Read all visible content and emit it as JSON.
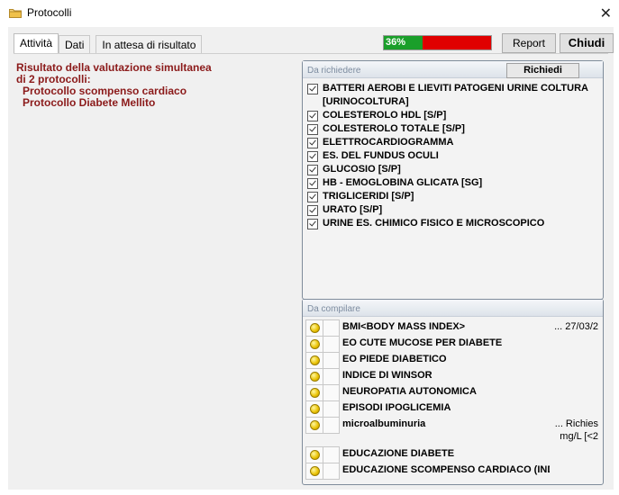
{
  "window": {
    "title": "Protocolli"
  },
  "tabs": [
    {
      "label": "Attività",
      "active": true
    },
    {
      "label": "Dati",
      "active": false
    },
    {
      "label": "In attesa di risultato",
      "active": false
    }
  ],
  "progress": {
    "value": 36,
    "label": "36%",
    "fill_color": "#1a9f2a",
    "rest_color": "#e00000"
  },
  "buttons": {
    "report": "Report",
    "chiudi": "Chiudi"
  },
  "result": {
    "line1": "Risultato della valutazione simultanea",
    "line2": "di 2 protocolli:",
    "protocols": [
      "Protocollo scompenso cardiaco",
      "Protocollo Diabete Mellito"
    ]
  },
  "requests_panel": {
    "title": "Da richiedere",
    "button": "Richiedi",
    "items": [
      "BATTERI AEROBI E LIEVITI PATOGENI URINE COLTURA [URINOCOLTURA]",
      "COLESTEROLO HDL [S/P]",
      "COLESTEROLO TOTALE [S/P]",
      "ELETTROCARDIOGRAMMA",
      "ES. DEL FUNDUS OCULI",
      "GLUCOSIO [S/P]",
      "HB - EMOGLOBINA GLICATA [SG]",
      "TRIGLICERIDI [S/P]",
      "URATO [S/P]",
      "URINE ES. CHIMICO FISICO E MICROSCOPICO"
    ]
  },
  "compile_panel": {
    "title": "Da compilare",
    "items": [
      {
        "name": "BMI<BODY MASS INDEX>",
        "extra": "... 27/03/2"
      },
      {
        "name": "EO CUTE MUCOSE PER DIABETE",
        "extra": ""
      },
      {
        "name": "EO PIEDE DIABETICO",
        "extra": ""
      },
      {
        "name": "INDICE DI WINSOR",
        "extra": ""
      },
      {
        "name": "NEUROPATIA AUTONOMICA",
        "extra": ""
      },
      {
        "name": "EPISODI IPOGLICEMIA",
        "extra": ""
      },
      {
        "name": "microalbuminuria",
        "extra": "... Richies",
        "extra2": "mg/L [<2"
      },
      {
        "name": "EDUCAZIONE DIABETE",
        "extra": ""
      },
      {
        "name": "EDUCAZIONE SCOMPENSO CARDIACO (INDIV",
        "extra": ""
      }
    ]
  }
}
